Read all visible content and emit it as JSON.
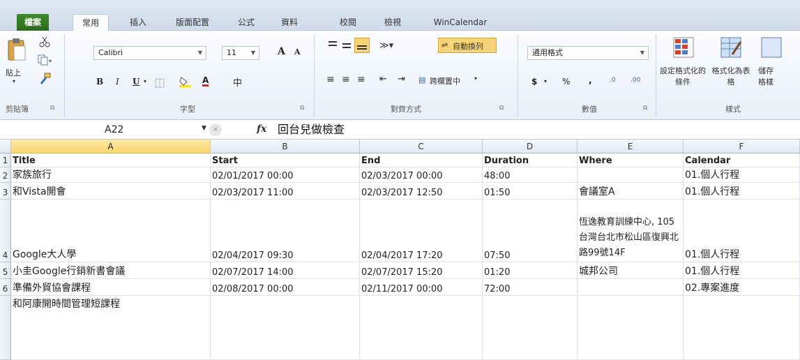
{
  "tabs": {
    "file": "檔案",
    "items": [
      "常用",
      "插入",
      "版面配置",
      "公式",
      "資料",
      "校閱",
      "檢視",
      "WinCalendar"
    ]
  },
  "ribbon": {
    "clipboard": {
      "paste_label": "貼上",
      "group_label": "剪貼簿"
    },
    "font": {
      "font_name": "Calibri",
      "font_size": "11",
      "grow_label": "A",
      "shrink_label": "A",
      "bold": "B",
      "italic": "I",
      "underline": "U",
      "font_color_label": "A",
      "phonetic_label": "中",
      "group_label": "字型"
    },
    "alignment": {
      "wrap_text": "自動換列",
      "merge_center": "跨欄置中",
      "group_label": "對齊方式"
    },
    "number": {
      "format": "通用格式",
      "currency": "$",
      "percent": "%",
      "comma": ",",
      "inc_decimal": ".0",
      "dec_decimal": ".00",
      "group_label": "數值"
    },
    "styles": {
      "conditional_format": "設定格式化的條件",
      "format_as_table": "格式化為表格",
      "cell_styles": "儲存格樣式",
      "group_label": "樣式"
    }
  },
  "formula_bar": {
    "name_box": "A22",
    "fx": "fx",
    "cancel": "×",
    "content": "回台兒做檢查"
  },
  "grid": {
    "columns": [
      "A",
      "B",
      "C",
      "D",
      "E",
      "F"
    ],
    "rows": [
      {
        "num": "1",
        "cells": [
          "Title",
          "Start",
          "End",
          "Duration",
          "Where",
          "Calendar"
        ]
      },
      {
        "num": "2",
        "cells": [
          "家族旅行",
          "02/01/2017 00:00",
          "02/03/2017 00:00",
          "48:00",
          "",
          "01.個人行程"
        ]
      },
      {
        "num": "3",
        "cells": [
          "和Vista開會",
          "02/03/2017 11:00",
          "02/03/2017 12:50",
          "01:50",
          "會議室A",
          "01.個人行程"
        ]
      },
      {
        "num": "4",
        "cells": [
          "Google大人學",
          "02/04/2017 09:30",
          "02/04/2017 17:20",
          "07:50",
          "恆逸教育訓練中心, 105台灣台北市松山區復興北路99號14F",
          "01.個人行程"
        ]
      },
      {
        "num": "5",
        "cells": [
          "小圭Google行銷新書會議",
          "02/07/2017 14:00",
          "02/07/2017 15:20",
          "01:20",
          "城邦公司",
          "01.個人行程"
        ]
      },
      {
        "num": "6",
        "cells": [
          "準備外貿協會課程",
          "02/08/2017 00:00",
          "02/11/2017 00:00",
          "72:00",
          "",
          "02.專案進度"
        ]
      },
      {
        "num": "",
        "cells": [
          "和阿康開時間管理短課程",
          "",
          "",
          "",
          "",
          ""
        ]
      }
    ]
  }
}
